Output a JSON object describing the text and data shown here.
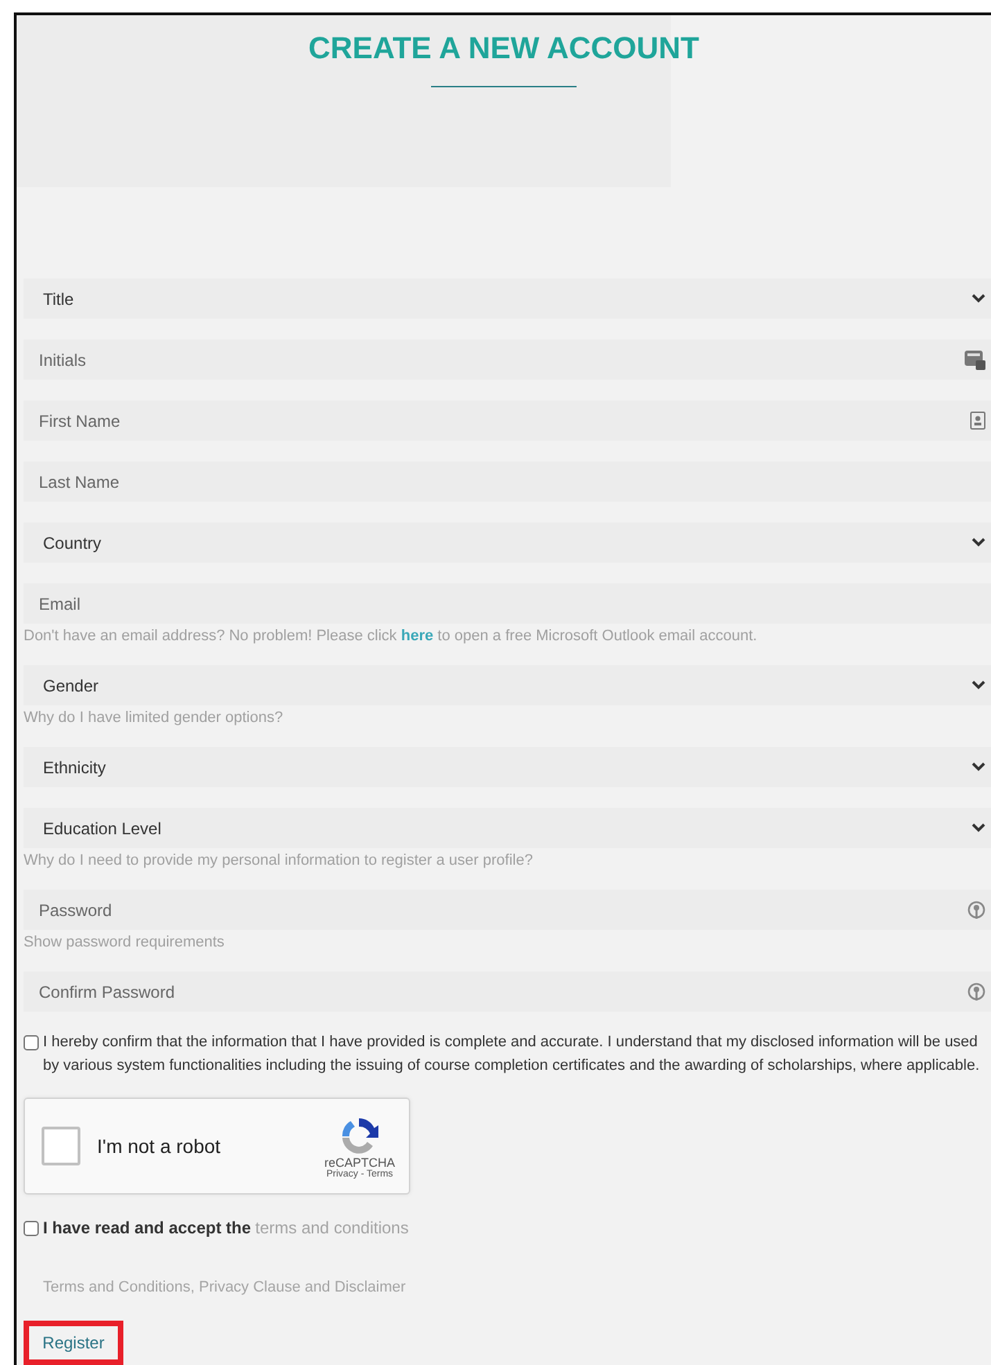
{
  "heading": "CREATE A NEW ACCOUNT",
  "fields": [
    {
      "kind": "select",
      "label": "Title"
    },
    {
      "kind": "initials",
      "placeholder": "Initials"
    },
    {
      "kind": "contact",
      "placeholder": "First Name"
    },
    {
      "kind": "input",
      "placeholder": "Last Name"
    },
    {
      "kind": "select",
      "label": "Country"
    },
    {
      "kind": "input",
      "placeholder": "Email",
      "help": {
        "before": "Don't have an email address? No problem! Please click",
        "link": "here",
        "after": "to open a free Microsoft Outlook email account."
      }
    },
    {
      "kind": "select",
      "label": "Gender",
      "help": {
        "before": "Why do I have limited gender options?"
      }
    },
    {
      "kind": "select",
      "label": "Ethnicity"
    },
    {
      "kind": "select",
      "label": "Education Level",
      "help": {
        "before": "Why do I need to provide my personal information to register a user profile?"
      }
    },
    {
      "kind": "secret",
      "placeholder": "Password",
      "help": {
        "before": "Show password requirements"
      }
    },
    {
      "kind": "secret",
      "placeholder": "Confirm Password"
    }
  ],
  "confirm": {
    "checked": false,
    "text": "I hereby confirm that the information that I have provided is complete and accurate. I understand that my disclosed information will be used by various system functionalities including the issuing of course completion certificates and the awarding of scholarships, where applicable."
  },
  "captcha": {
    "checked": false,
    "label": "I'm not a robot",
    "brand": "reCAPTCHA",
    "links": "Privacy - Terms"
  },
  "terms": {
    "checked": false,
    "text": "I have read and accept the",
    "link": "terms and conditions"
  },
  "terms_link": "Terms and Conditions, Privacy Clause and Disclaimer",
  "register": {
    "label": "Register",
    "highlighted": true
  }
}
